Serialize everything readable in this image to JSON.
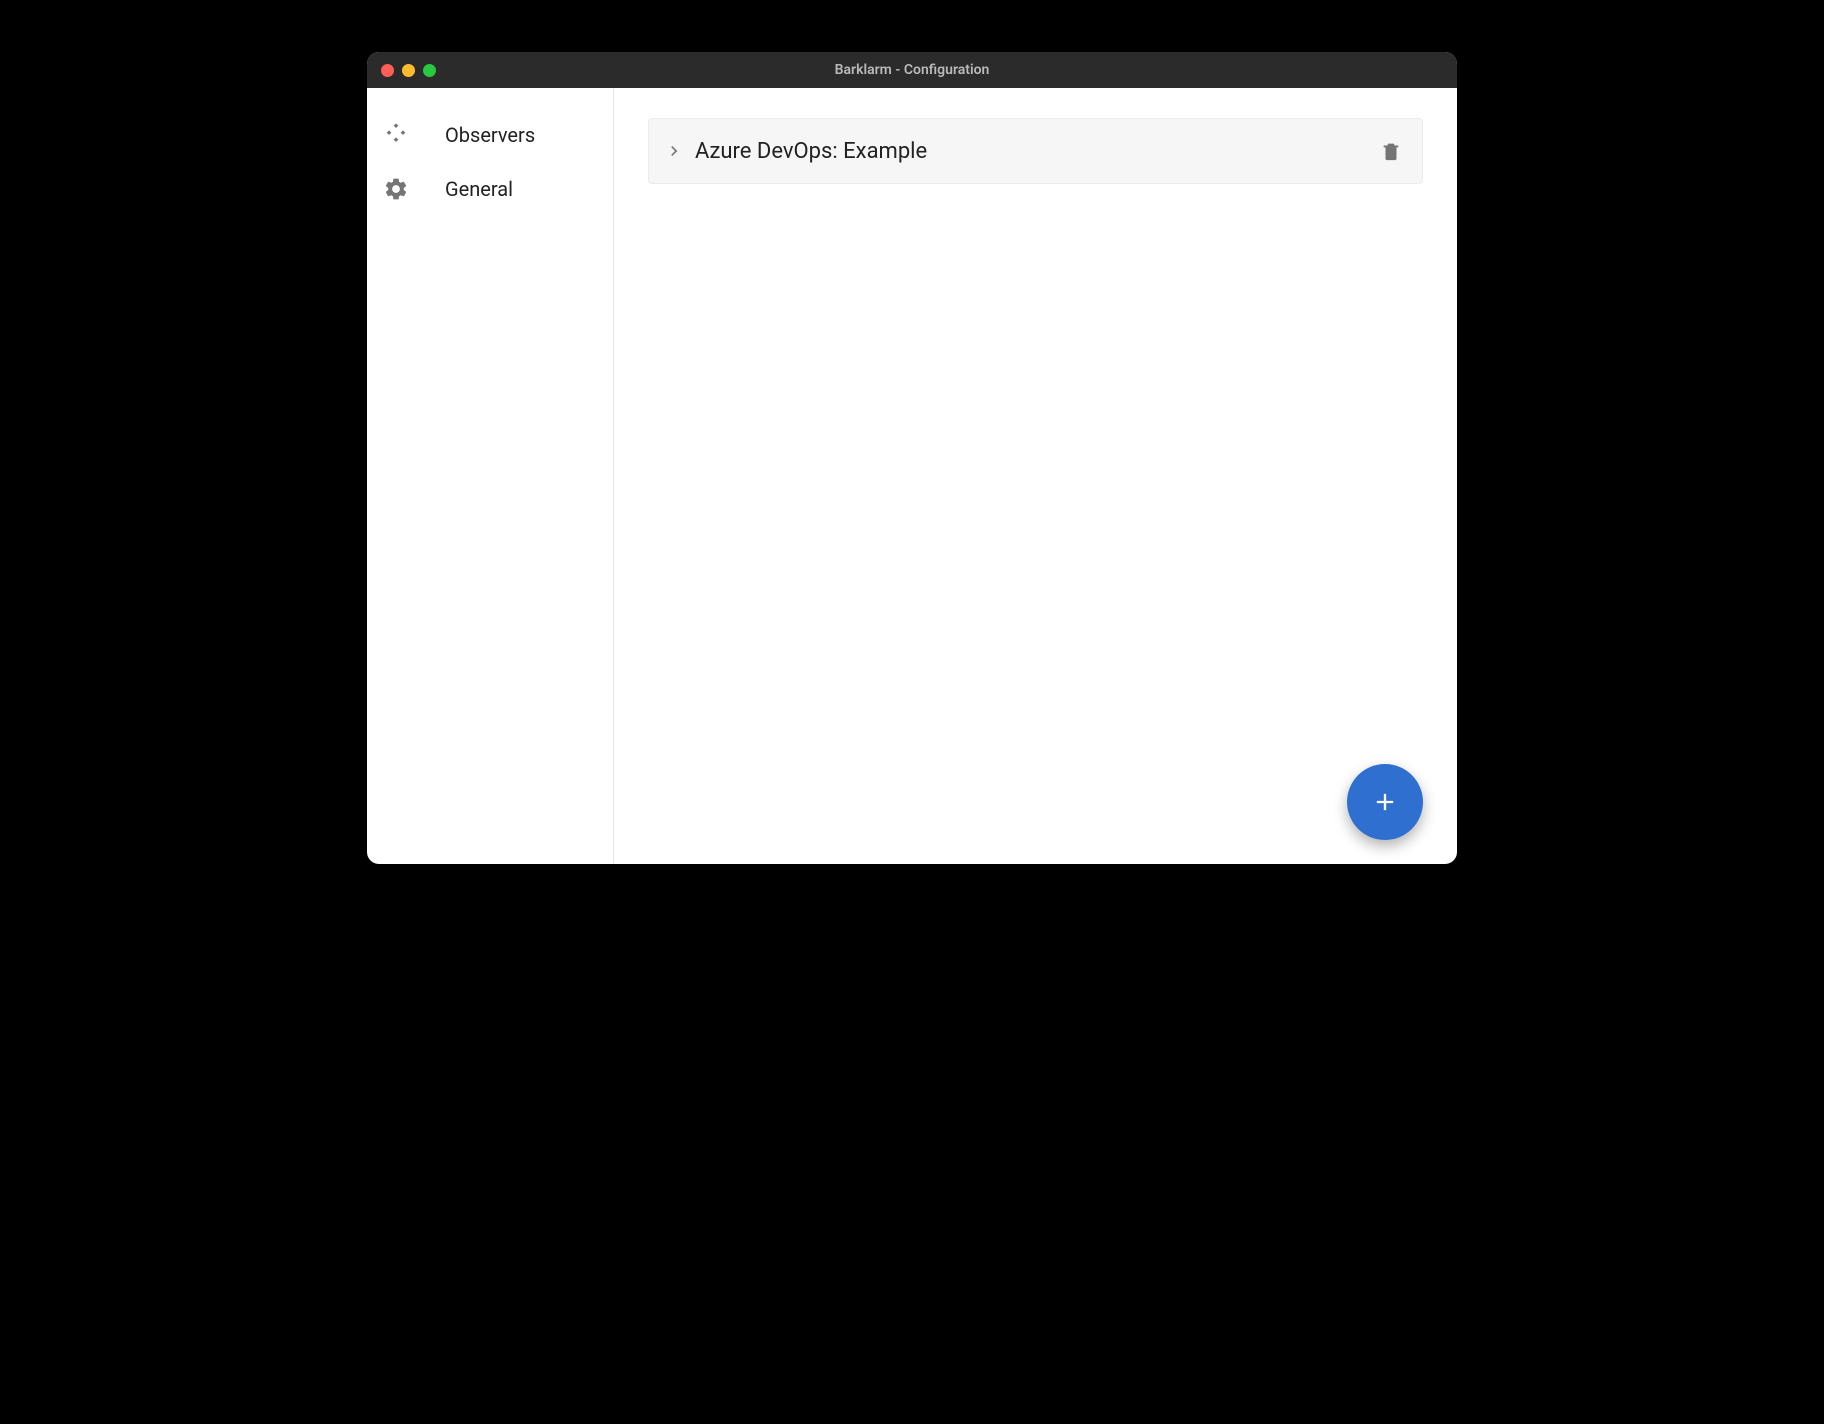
{
  "window": {
    "title": "Barklarm - Configuration"
  },
  "sidebar": {
    "items": [
      {
        "icon": "api-icon",
        "label": "Observers"
      },
      {
        "icon": "gear-icon",
        "label": "General"
      }
    ]
  },
  "main": {
    "observers": [
      {
        "label": "Azure DevOps: Example"
      }
    ]
  },
  "icons": {
    "add": "plus-icon",
    "delete": "trash-icon",
    "expand": "chevron-right-icon"
  },
  "colors": {
    "fab": "#2f6fd0",
    "row_bg": "#f6f6f6",
    "icon_gray": "#757575"
  }
}
